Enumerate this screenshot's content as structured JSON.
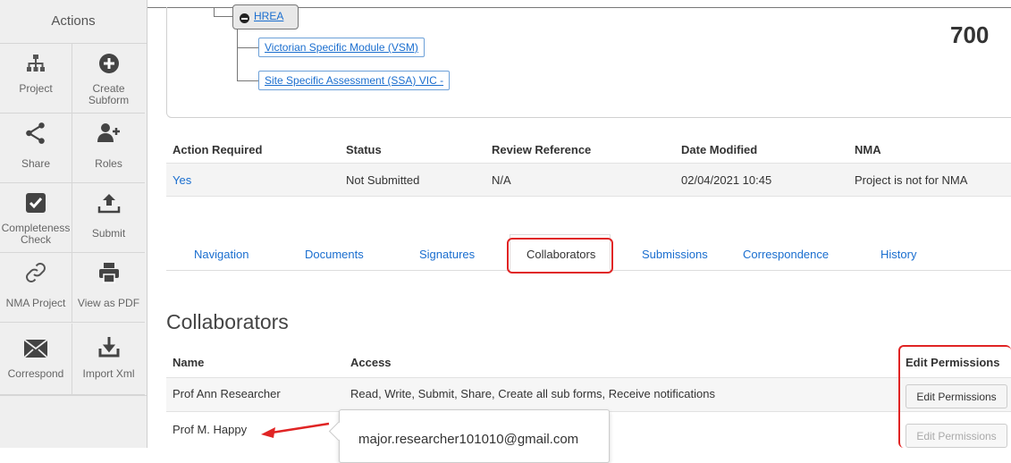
{
  "sidebar": {
    "title": "Actions",
    "buttons": [
      {
        "label_1": "Project",
        "label_2": "",
        "icon": "hierarchy-icon"
      },
      {
        "label_1": "Create",
        "label_2": "Subform",
        "icon": "plus-circle-icon"
      },
      {
        "label_1": "Share",
        "label_2": "",
        "icon": "share-icon"
      },
      {
        "label_1": "Roles",
        "label_2": "",
        "icon": "user-plus-icon"
      },
      {
        "label_1": "Completeness",
        "label_2": "Check",
        "icon": "checkbox-icon"
      },
      {
        "label_1": "Submit",
        "label_2": "",
        "icon": "upload-icon"
      },
      {
        "label_1": "NMA Project",
        "label_2": "",
        "icon": "link-icon"
      },
      {
        "label_1": "View as PDF",
        "label_2": "",
        "icon": "printer-icon"
      },
      {
        "label_1": "Correspond",
        "label_2": "",
        "icon": "envelope-icon"
      },
      {
        "label_1": "Import Xml",
        "label_2": "",
        "icon": "import-icon"
      }
    ]
  },
  "tree": {
    "root": "HREA",
    "children": [
      "Victorian Specific Module (VSM)",
      "Site Specific Assessment (SSA) VIC -"
    ]
  },
  "project_number": "700",
  "summary": {
    "headers": [
      "Action Required",
      "Status",
      "Review Reference",
      "Date Modified",
      "NMA"
    ],
    "values": [
      "Yes",
      "Not Submitted",
      "N/A",
      "02/04/2021 10:45",
      "Project is not for NMA"
    ]
  },
  "tabs": [
    "Navigation",
    "Documents",
    "Signatures",
    "Collaborators",
    "Submissions",
    "Correspondence",
    "History"
  ],
  "active_tab": "Collaborators",
  "collaborators": {
    "title": "Collaborators",
    "headers": {
      "name": "Name",
      "access": "Access",
      "edit": "Edit Permissions"
    },
    "rows": [
      {
        "name": "Prof Ann Researcher",
        "access": "Read, Write, Submit, Share, Create all sub forms, Receive notifications",
        "button": "Edit Permissions"
      },
      {
        "name": "Prof M. Happy",
        "access": "",
        "button": "Edit Permissions"
      }
    ],
    "tooltip_email": "major.researcher101010@gmail.com"
  },
  "colors": {
    "link": "#1a6ecf",
    "highlight": "#e02424",
    "sidebar_bg": "#efefef"
  }
}
